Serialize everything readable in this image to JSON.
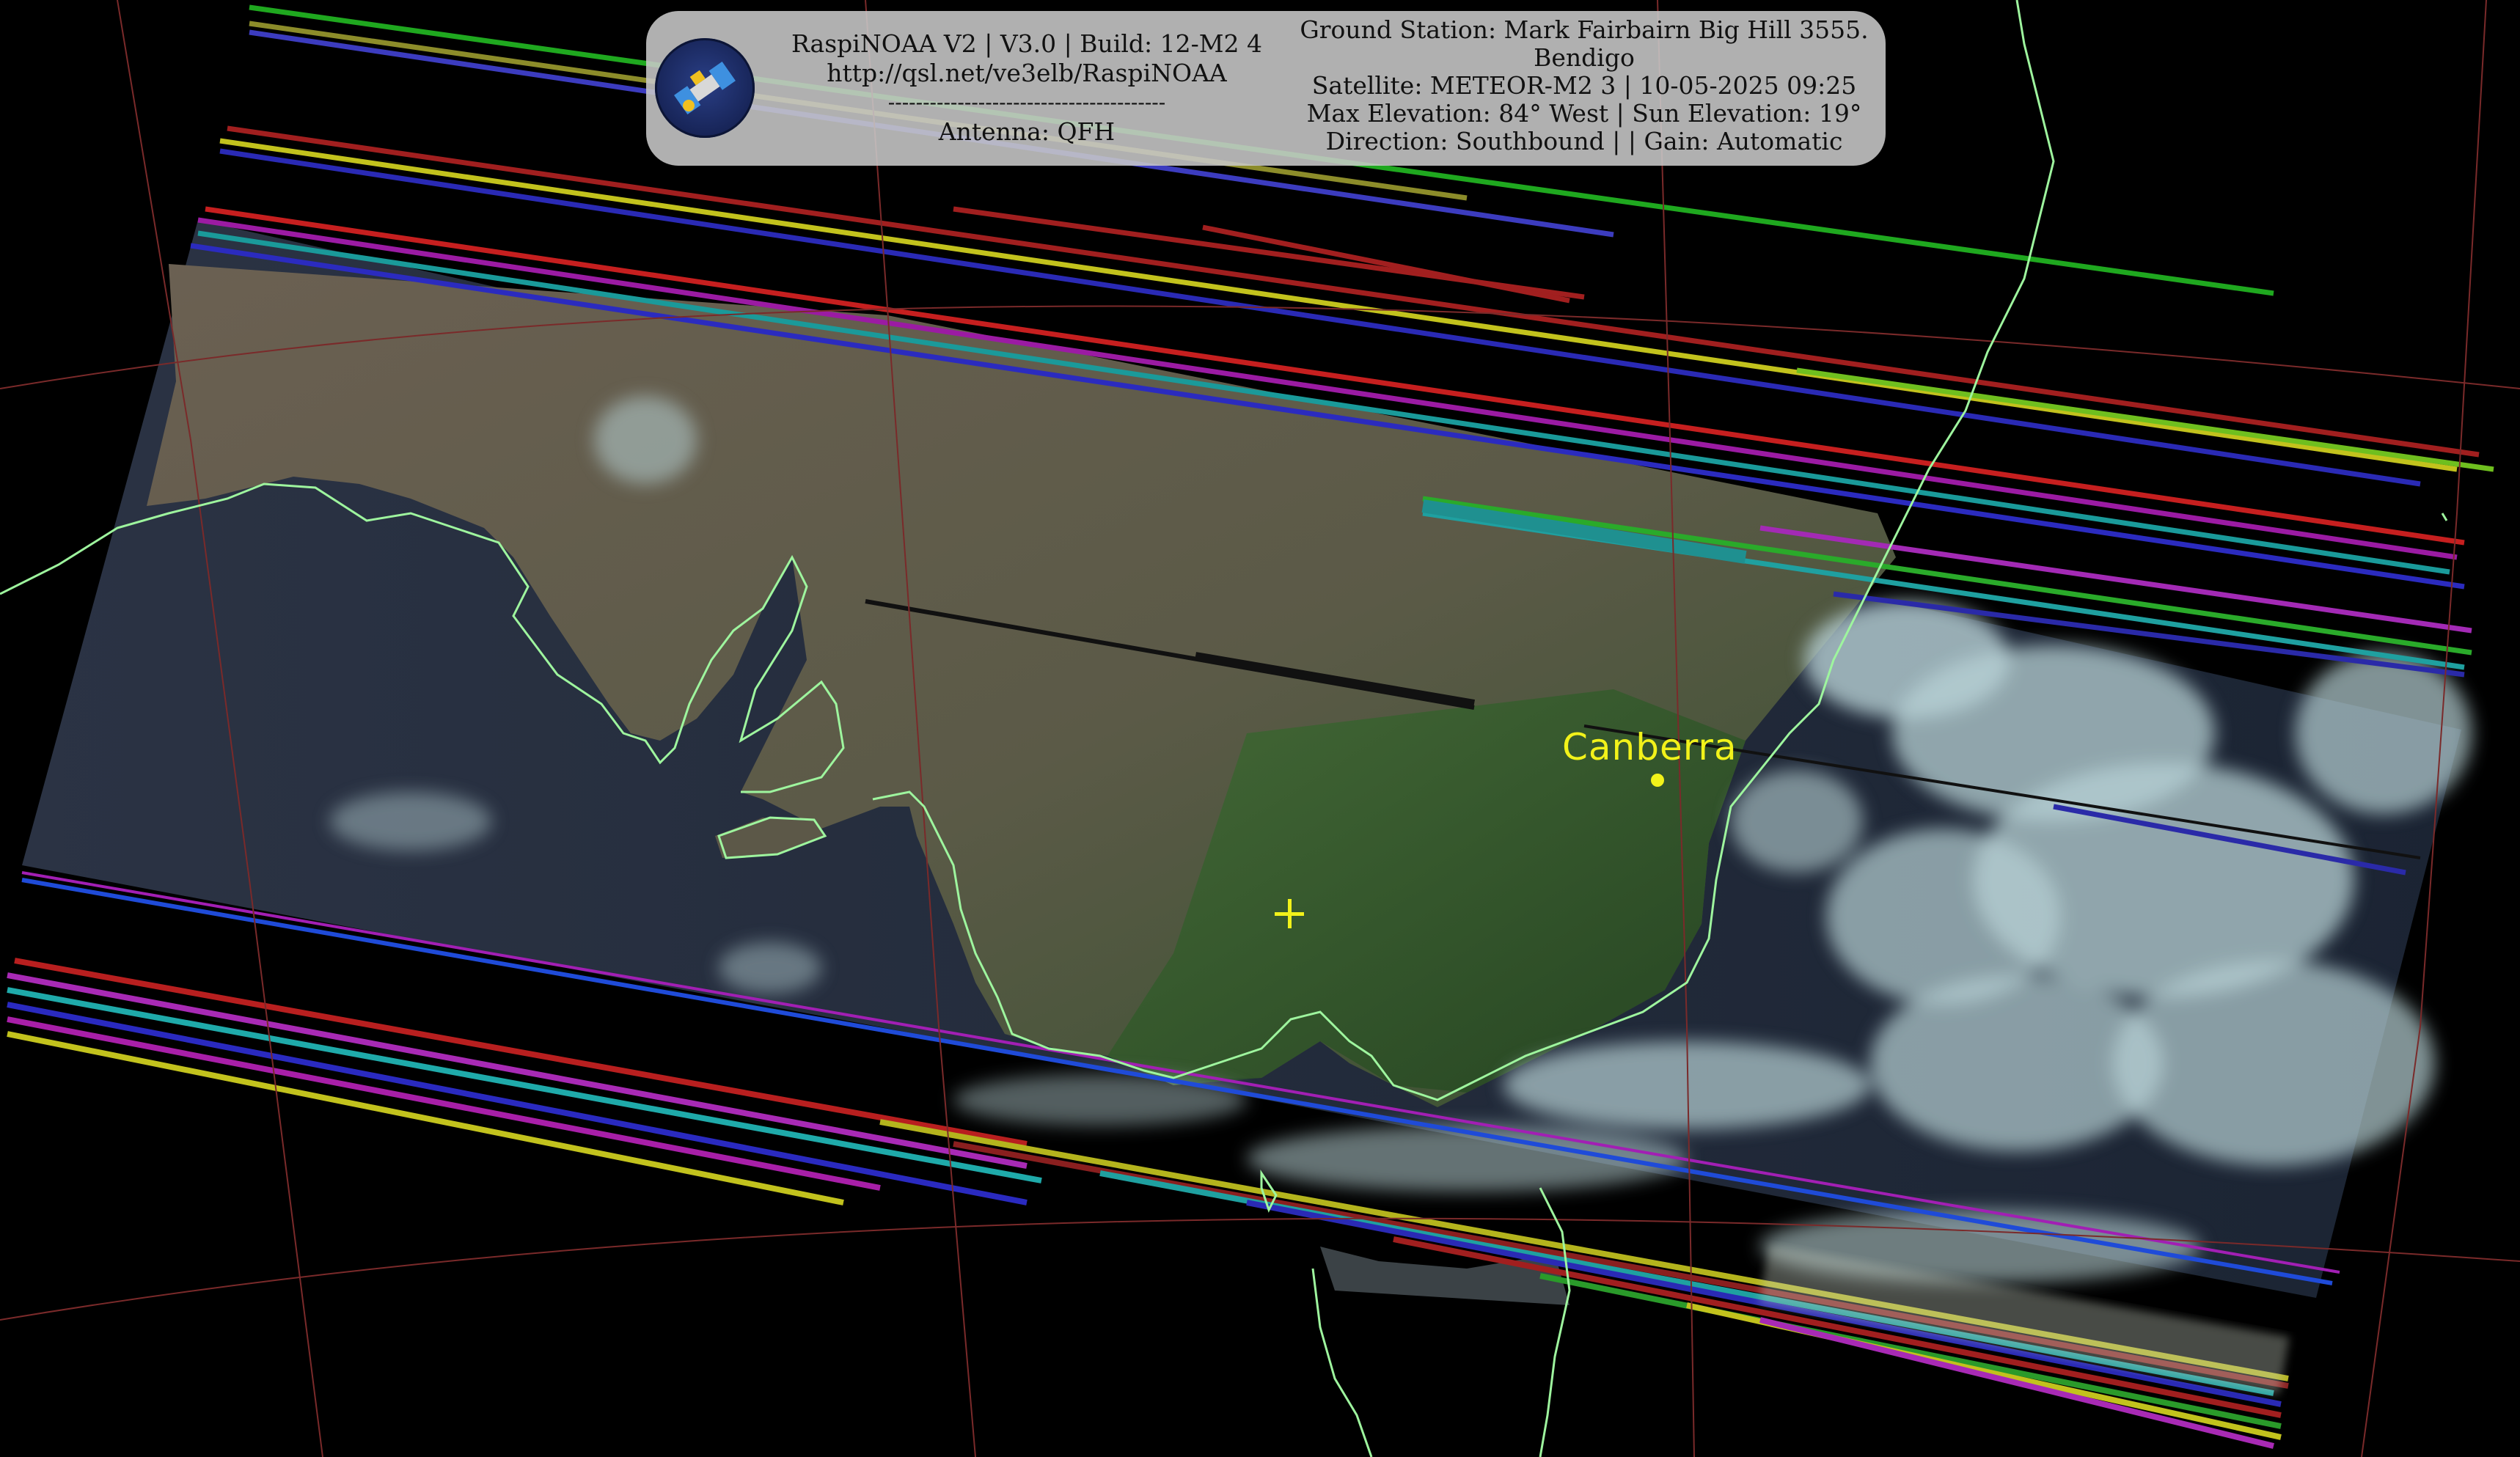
{
  "header": {
    "left_lines": [
      "RaspiNOAA V2 | V3.0 | Build: 12-M2 4",
      "http://qsl.net/ve3elb/RaspiNOAA",
      "----------------------------------------",
      "Antenna: QFH"
    ],
    "right_lines": [
      "Ground Station: Mark Fairbairn Big Hill 3555.",
      "Bendigo",
      "Satellite: METEOR-M2 3 | 10-05-2025 09:25",
      "Max Elevation: 84° West | Sun Elevation: 19°",
      "Direction: Southbound | | Gain: Automatic"
    ]
  },
  "map": {
    "city_label": "Canberra",
    "colors": {
      "coastline": "#9ef59e",
      "grid": "#8a2a2a",
      "marker": "#f2f21a",
      "land": "#5a5446",
      "ocean": "#1a2233",
      "cloud": "#b9d2d6"
    },
    "icons": [
      "satellite-logo-icon",
      "station-cross-icon",
      "city-dot-icon"
    ]
  }
}
